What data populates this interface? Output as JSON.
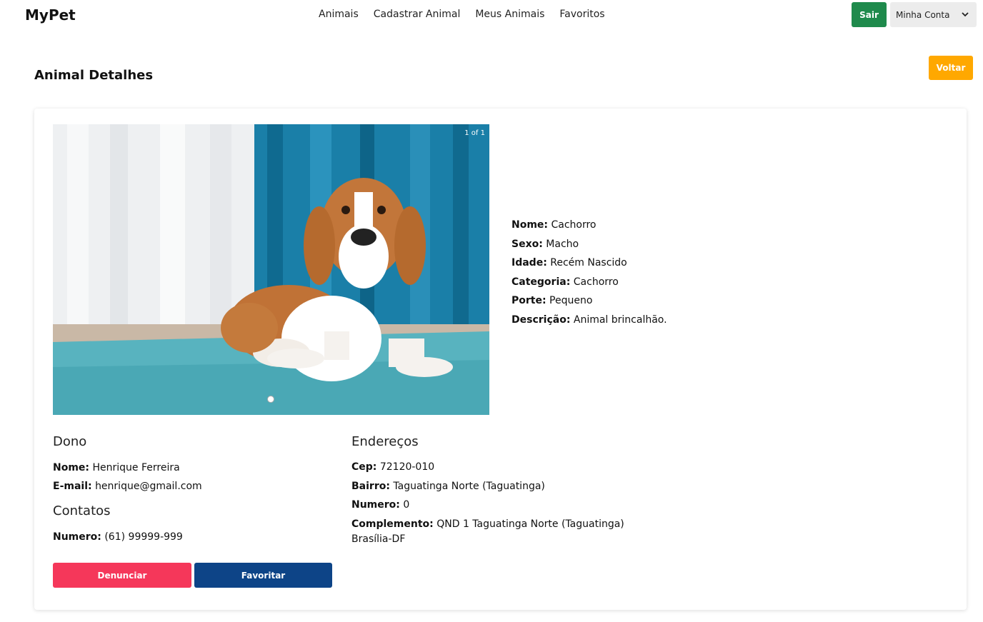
{
  "brand": "MyPet",
  "nav": {
    "links": [
      "Animais",
      "Cadastrar Animal",
      "Meus Animais",
      "Favoritos"
    ],
    "logout_label": "Sair",
    "account_label": "Minha Conta"
  },
  "page": {
    "title": "Animal Detalhes",
    "back_label": "Voltar"
  },
  "carousel": {
    "counter": "1 of 1",
    "image": "beagle-dog-photo"
  },
  "animal": {
    "name_label": "Nome:",
    "name": "Cachorro",
    "sex_label": "Sexo:",
    "sex": "Macho",
    "age_label": "Idade:",
    "age": "Recém Nascido",
    "category_label": "Categoria:",
    "category": "Cachorro",
    "size_label": "Porte:",
    "size": "Pequeno",
    "description_label": "Descrição:",
    "description": "Animal brincalhão."
  },
  "owner": {
    "title": "Dono",
    "name_label": "Nome:",
    "name": "Henrique Ferreira",
    "email_label": "E-mail:",
    "email": "henrique@gmail.com"
  },
  "contacts": {
    "title": "Contatos",
    "number_label": "Numero:",
    "number": "(61) 99999-999"
  },
  "address": {
    "title": "Endereços",
    "cep_label": "Cep:",
    "cep": "72120-010",
    "neighborhood_label": "Bairro:",
    "neighborhood": "Taguatinga Norte (Taguatinga)",
    "number_label": "Numero:",
    "number": "0",
    "complement_label": "Complemento:",
    "complement": "QND 1 Taguatinga Norte (Taguatinga)",
    "city": "Brasília-DF"
  },
  "actions": {
    "report_label": "Denunciar",
    "favorite_label": "Favoritar"
  },
  "colors": {
    "logout": "#1f8a4c",
    "back": "#ffa800",
    "report": "#f5375a",
    "favorite": "#0d4487"
  }
}
